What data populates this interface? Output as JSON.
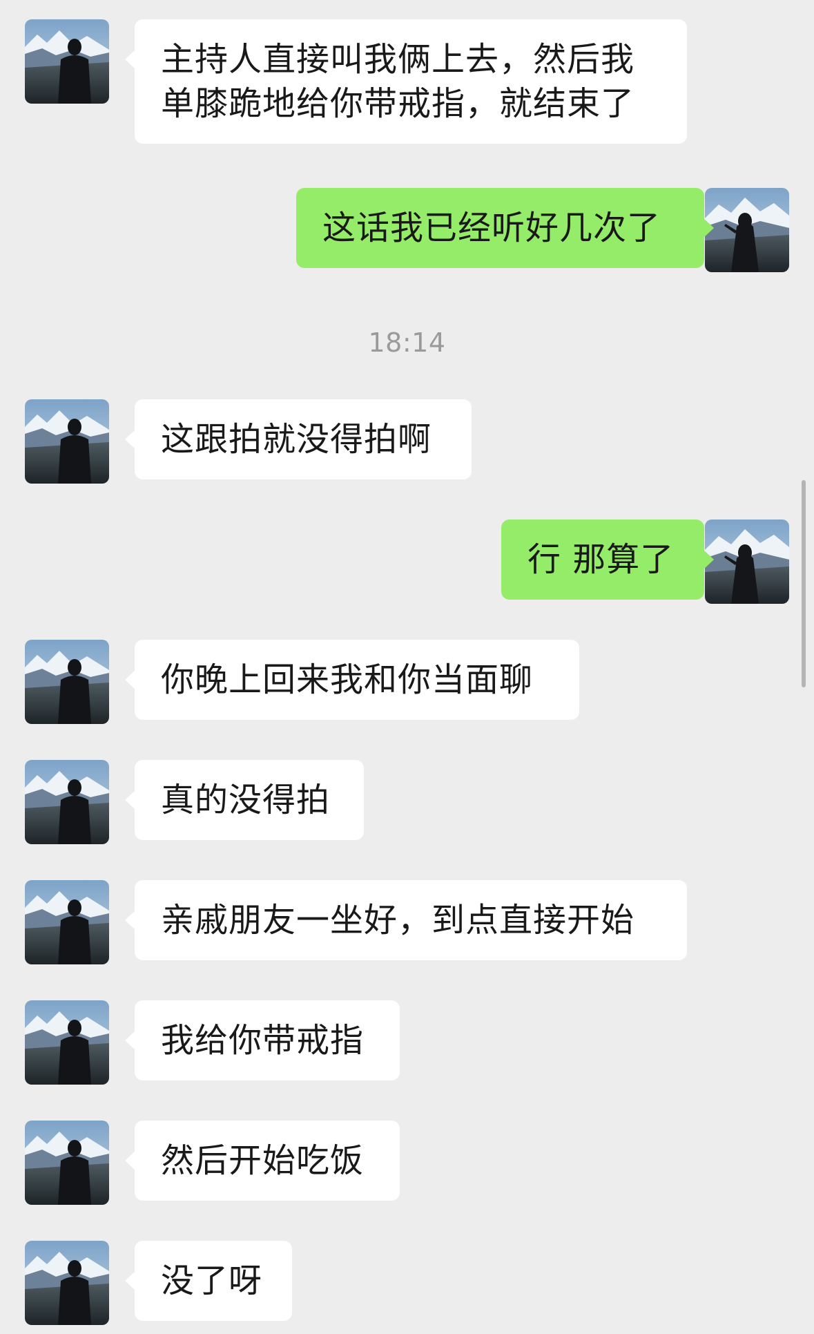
{
  "timestamp": "18:14",
  "messages": [
    {
      "side": "left",
      "text": "主持人直接叫我俩上去，然后我\n单膝跪地给你带戒指，就结束了"
    },
    {
      "side": "right",
      "text": "这话我已经听好几次了"
    },
    {
      "side": "left",
      "text": "这跟拍就没得拍啊"
    },
    {
      "side": "right",
      "text": "行 那算了"
    },
    {
      "side": "left",
      "text": "你晚上回来我和你当面聊"
    },
    {
      "side": "left",
      "text": "真的没得拍"
    },
    {
      "side": "left",
      "text": "亲戚朋友一坐好，到点直接开始"
    },
    {
      "side": "left",
      "text": "我给你带戒指"
    },
    {
      "side": "left",
      "text": "然后开始吃饭"
    },
    {
      "side": "left",
      "text": "没了呀"
    }
  ],
  "colors": {
    "background": "#ededed",
    "incoming_bubble": "#ffffff",
    "outgoing_bubble": "#95ec69",
    "text": "#191919",
    "timestamp": "#9a9a9a"
  },
  "icons": {
    "contact_avatar": "avatar-mountain-silhouette-icon",
    "self_avatar": "avatar-mountain-girl-icon"
  }
}
